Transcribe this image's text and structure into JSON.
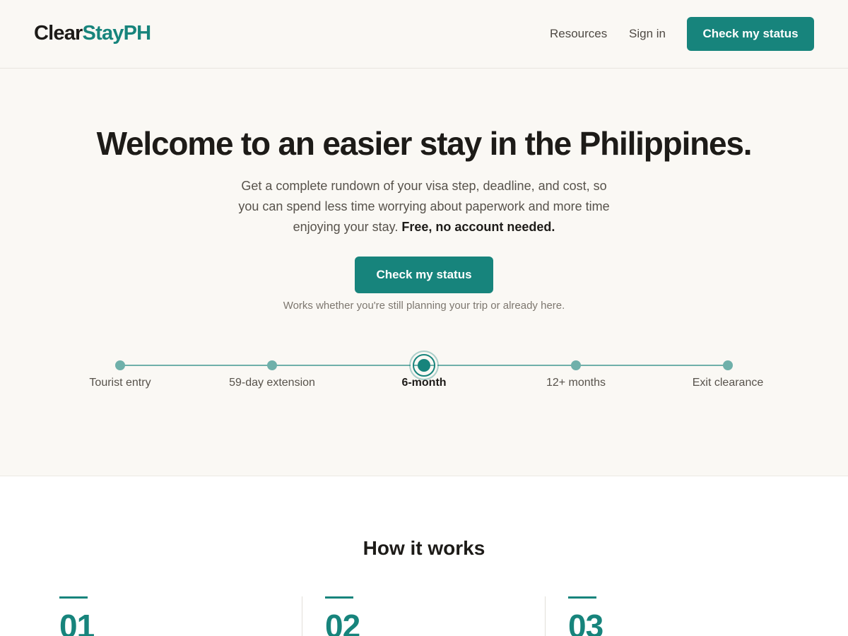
{
  "header": {
    "logo_part1": "Clear",
    "logo_part2": "StayPH",
    "nav": {
      "resources": "Resources",
      "sign_in": "Sign in"
    },
    "cta": "Check my status"
  },
  "hero": {
    "title": "Welcome to an easier stay in the Philippines.",
    "subtitle": "Get a complete rundown of your visa step, deadline, and cost, so you can spend less time worrying about paperwork and more time enjoying your stay.",
    "subtitle_emphasis": "Free, no account needed.",
    "cta": "Check my status",
    "note": "Works whether you're still planning your trip or already here."
  },
  "timeline": {
    "active_index": 2,
    "steps": [
      {
        "label": "Tourist entry"
      },
      {
        "label": "59-day extension"
      },
      {
        "label": "6-month"
      },
      {
        "label": "12+ months"
      },
      {
        "label": "Exit clearance"
      }
    ]
  },
  "how_it_works": {
    "title": "How it works",
    "steps": [
      {
        "number": "01"
      },
      {
        "number": "02"
      },
      {
        "number": "03"
      }
    ]
  },
  "colors": {
    "accent": "#17847c",
    "background": "#faf8f4",
    "text": "#1d1b18",
    "muted": "#57524b"
  }
}
